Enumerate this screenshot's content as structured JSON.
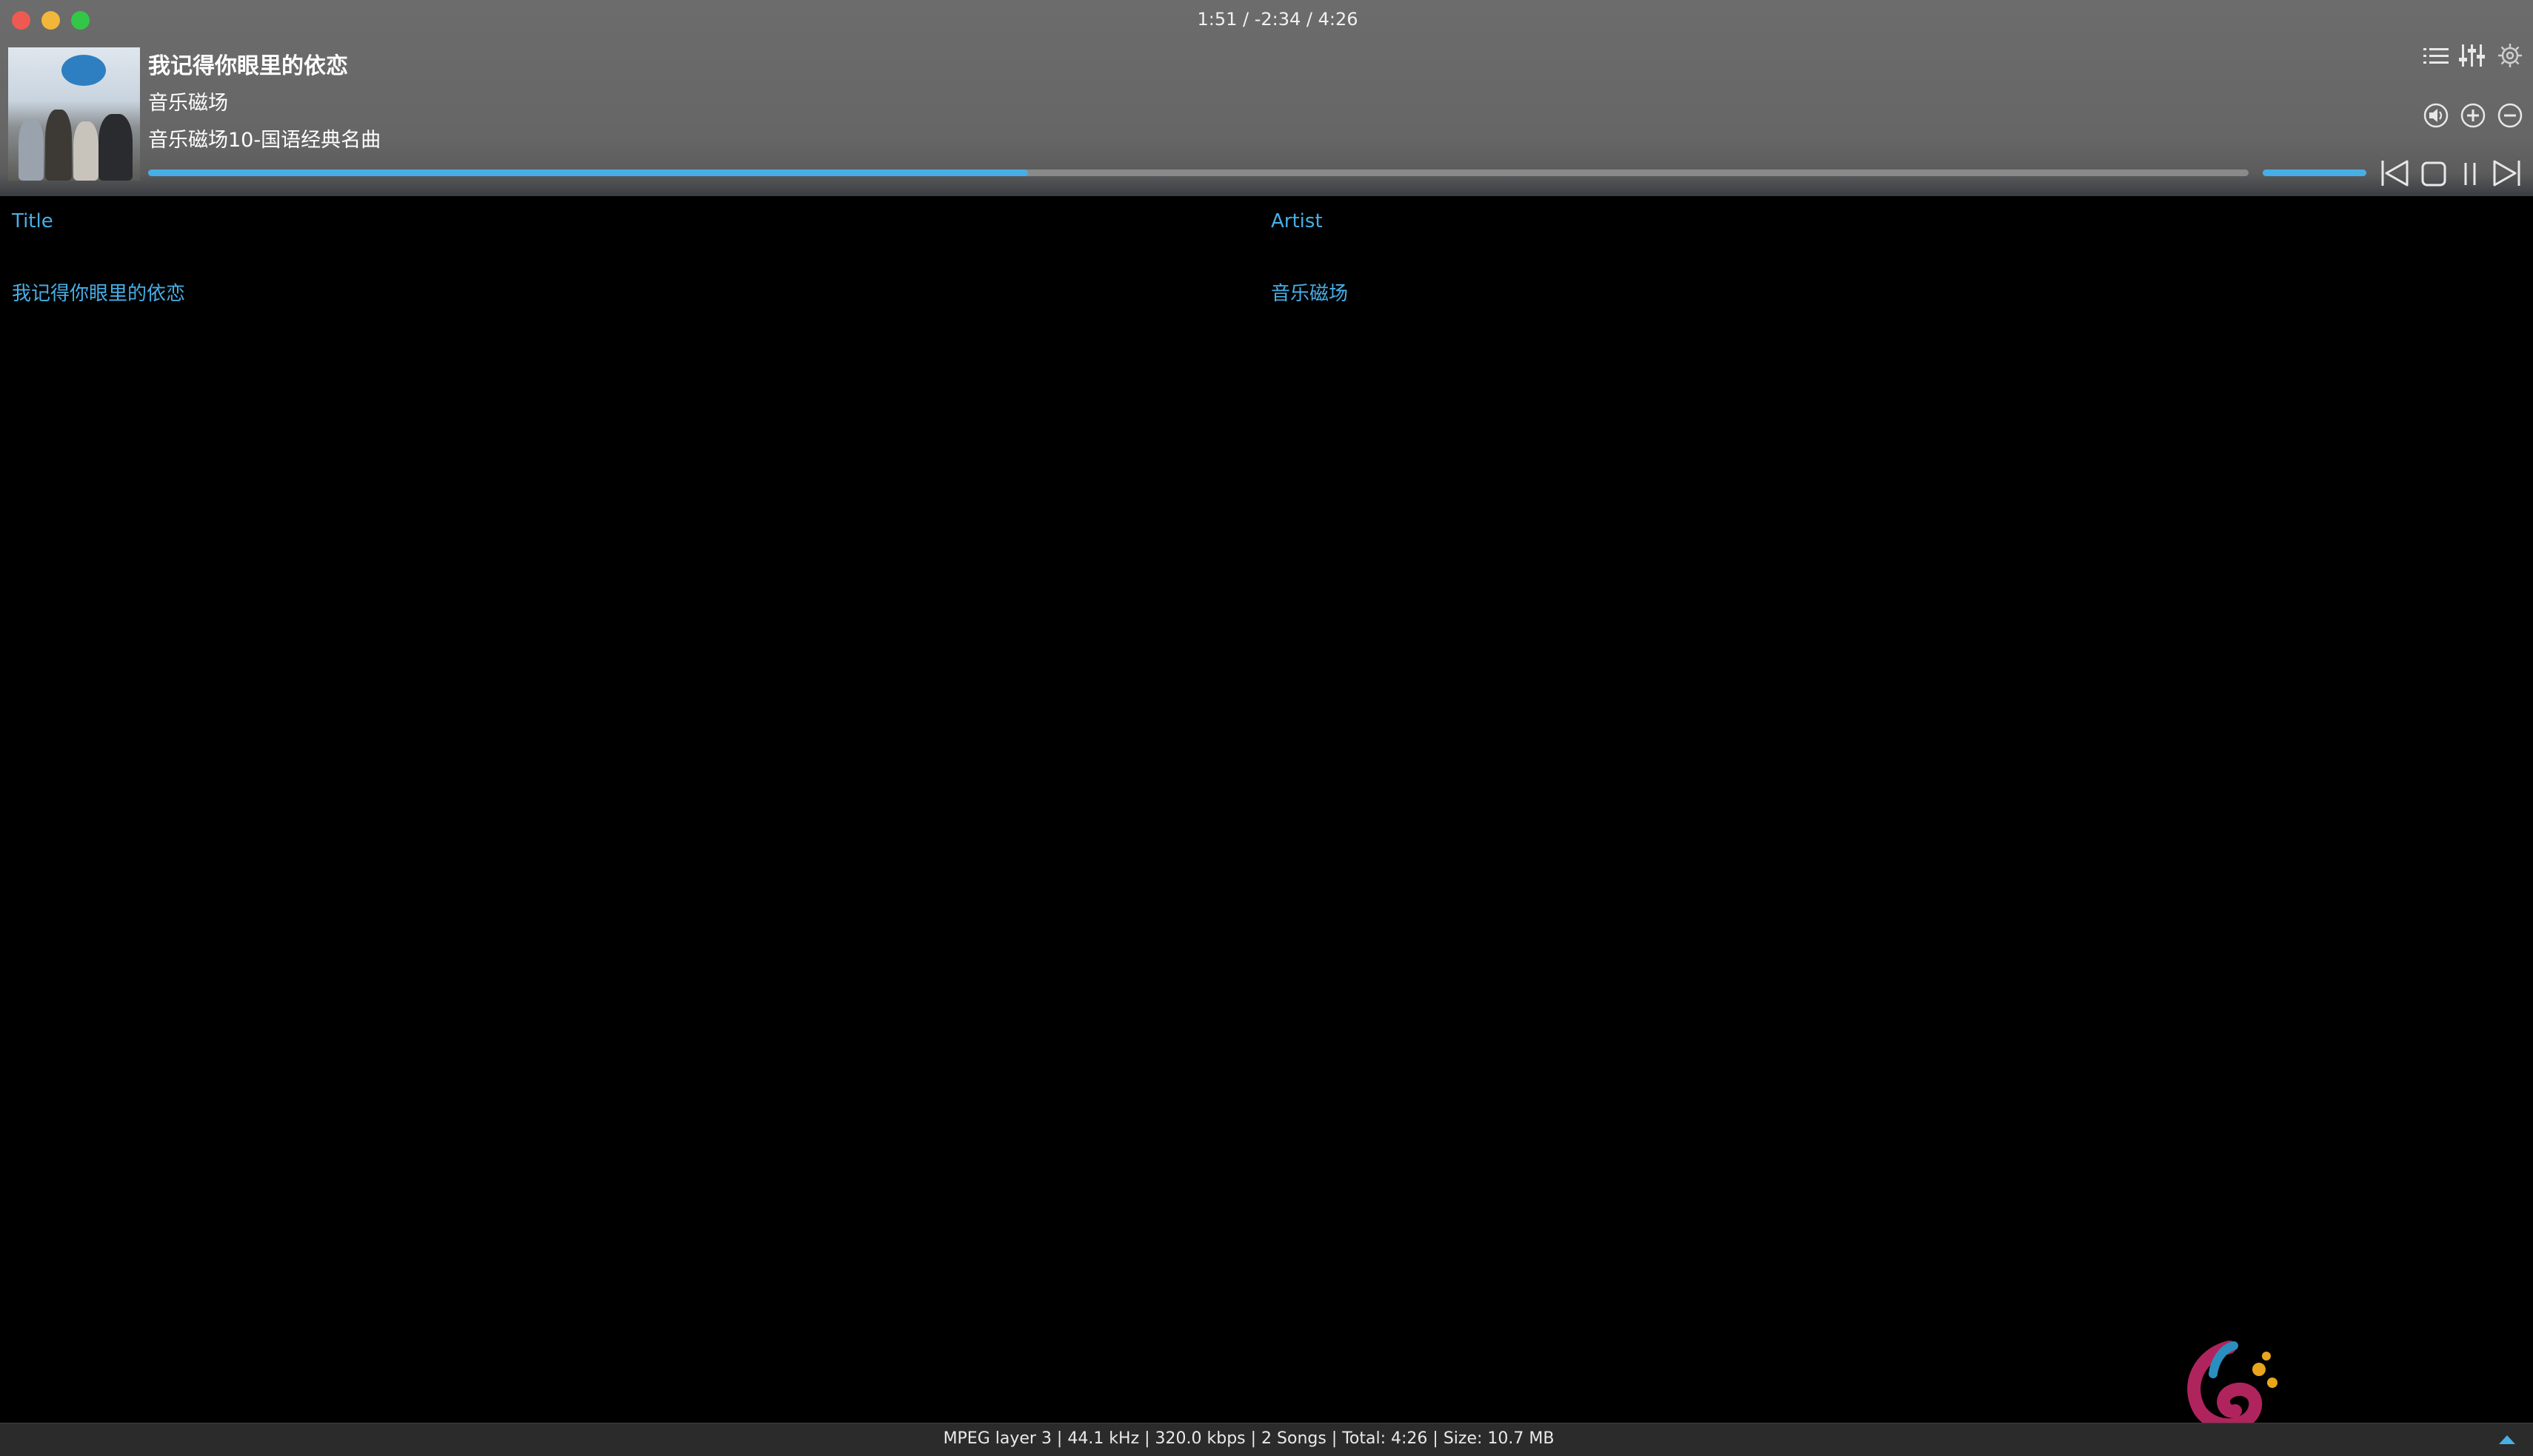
{
  "window": {
    "title": "1:51 / -2:34 / 4:26"
  },
  "now_playing": {
    "title": "我记得你眼里的依恋",
    "artist": "音乐磁场",
    "album": "音乐磁场10-国语经典名曲",
    "progress_fraction": 0.419,
    "volume_fraction": 1.0
  },
  "toolbar_icons": [
    "playlist-icon",
    "equalizer-icon",
    "settings-icon"
  ],
  "volume_icons": [
    "speaker-icon",
    "volume-up-icon",
    "volume-down-icon"
  ],
  "transport_icons": [
    "previous-icon",
    "stop-icon",
    "pause-icon",
    "next-icon"
  ],
  "playlist": {
    "columns": [
      "Title",
      "Artist"
    ],
    "rows": [
      {
        "title": "我记得你眼里的依恋",
        "artist": "音乐磁场"
      }
    ]
  },
  "status": {
    "text": "MPEG layer 3 | 44.1 kHz | 320.0 kbps | 2 Songs | Total: 4:26 | Size: 10.7 MB"
  },
  "colors": {
    "accent": "#47aee6",
    "header_bg": "#666666",
    "background": "#000000"
  }
}
